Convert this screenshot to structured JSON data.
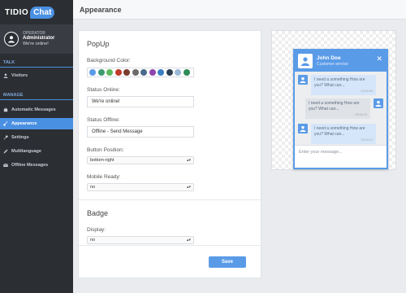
{
  "brand": {
    "name_part1": "TIDIO",
    "name_part2": "Chat"
  },
  "operator": {
    "role": "OPERATOR",
    "name": "Administrator",
    "status": "We're online!"
  },
  "sidebar": {
    "talk_label": "TALK",
    "talk_items": [
      {
        "label": "Visitors",
        "icon": "user-icon"
      }
    ],
    "manage_label": "MANAGE",
    "manage_items": [
      {
        "label": "Automatic Messages",
        "icon": "robot-icon"
      },
      {
        "label": "Appearance",
        "icon": "brush-icon",
        "active": true
      },
      {
        "label": "Settings",
        "icon": "wrench-icon"
      },
      {
        "label": "Multilanguage",
        "icon": "pencil-icon"
      },
      {
        "label": "Offline Messages",
        "icon": "mail-icon"
      }
    ]
  },
  "header": {
    "title": "Appearance"
  },
  "popup": {
    "heading": "PopUp",
    "bg_color_label": "Background Color:",
    "colors": [
      "#5a9be8",
      "#3d9970",
      "#5cb85c",
      "#c0392b",
      "#7a3b2e",
      "#6b6b6b",
      "#4a6b8a",
      "#8e44ad",
      "#3a7fc2",
      "#2c3e50",
      "#9ab8d8",
      "#2e8b57"
    ],
    "status_online_label": "Status Online:",
    "status_online_value": "We're online!",
    "status_offline_label": "Status Offline:",
    "status_offline_value": "Offline - Send Message",
    "button_position_label": "Button Position:",
    "button_position_value": "bottom-right",
    "mobile_ready_label": "Mobile Ready:",
    "mobile_ready_value": "no"
  },
  "badge": {
    "heading": "Badge",
    "display_label": "Display:",
    "display_value": "no"
  },
  "actions": {
    "save_label": "Save"
  },
  "preview": {
    "name": "John Doe",
    "role": "Customer service",
    "messages": [
      {
        "text": "I need a something How are you? What can...",
        "time": "13:00:00"
      },
      {
        "text": "I need a something How are you? What can...",
        "time": "13:00:13"
      },
      {
        "text": "I need a something How are you? What can...",
        "time": "13:00:13"
      }
    ],
    "input_placeholder": "Enter your message..."
  }
}
